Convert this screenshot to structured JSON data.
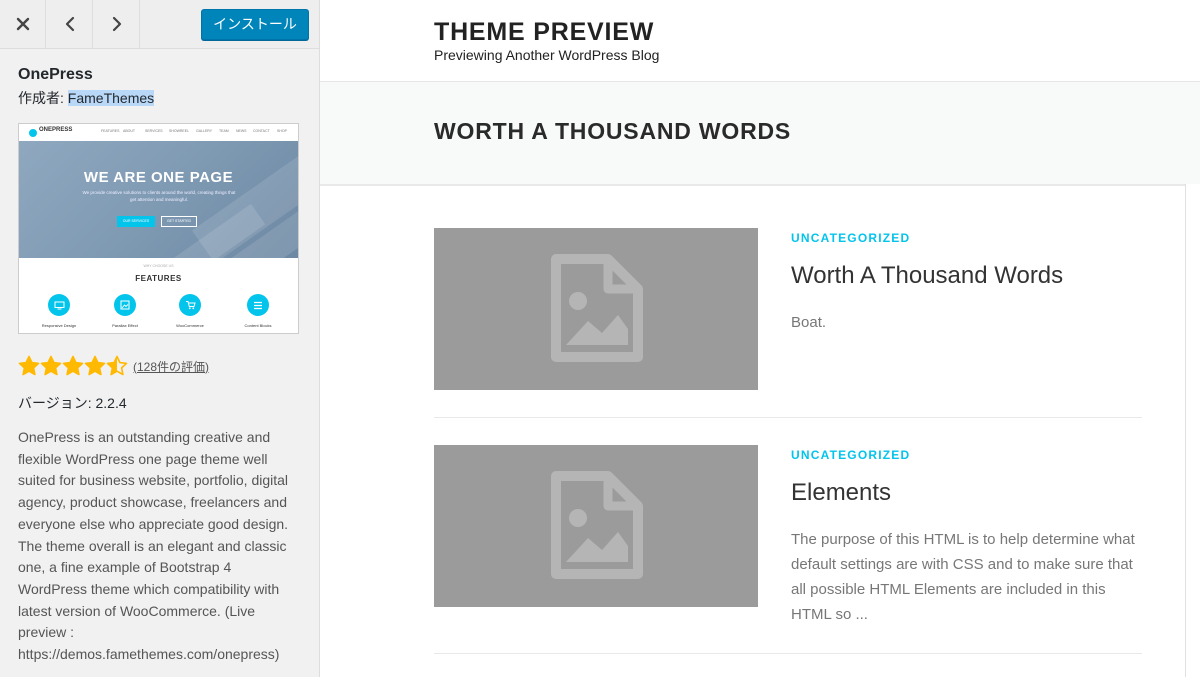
{
  "sidebar": {
    "toolbar": {
      "close_icon": "close-icon",
      "prev_icon": "chevron-left-icon",
      "next_icon": "chevron-right-icon",
      "install_label": "インストール"
    },
    "theme_name": "OnePress",
    "author_prefix": "作成者: ",
    "author_name": "FameThemes",
    "thumbnail": {
      "logo_text": "ONEPRESS",
      "menu": [
        "FEATURES",
        "ABOUT",
        "SERVICES",
        "SHOWREEL",
        "GALLERY",
        "TEAM",
        "NEWS",
        "CONTACT",
        "SHOP"
      ],
      "hero_title": "WE ARE ONE PAGE",
      "hero_subtitle": "We provide creative solutions to clients around the world, creating things that get attention and meaningful.",
      "btn_primary": "OUR SERVICES",
      "btn_secondary": "GET STARTED",
      "features_small": "WHY CHOOSE US",
      "features_title": "FEATURES",
      "features": [
        "Responsive Design",
        "Parallax Effect",
        "WooCommerce",
        "Content Blocks"
      ]
    },
    "rating": {
      "stars": 4.5,
      "count_label": "(128件の評価)"
    },
    "version_label": "バージョン: ",
    "version": "2.2.4",
    "description": "OnePress is an outstanding creative and flexible WordPress one page theme well suited for business website, portfolio, digital agency, product showcase, freelancers and everyone else who appreciate good design. The theme overall is an elegant and classic one, a fine example of Bootstrap 4 WordPress theme which compatibility with latest version of WooCommerce. (Live preview : https://demos.famethemes.com/onepress)"
  },
  "preview": {
    "site_title": "THEME PREVIEW",
    "site_description": "Previewing Another WordPress Blog",
    "page_title": "WORTH A THOUSAND WORDS",
    "posts": [
      {
        "category": "UNCATEGORIZED",
        "title": "Worth A Thousand Words",
        "excerpt": "Boat."
      },
      {
        "category": "UNCATEGORIZED",
        "title": "Elements",
        "excerpt": "The purpose of this HTML is to help determine what default settings are with CSS and to make sure that all possible HTML Elements are included in this HTML so ..."
      }
    ]
  },
  "colors": {
    "accent": "#03c4eb",
    "install_button": "#0085ba",
    "star": "#ffb900",
    "placeholder": "#9b9b9b"
  }
}
